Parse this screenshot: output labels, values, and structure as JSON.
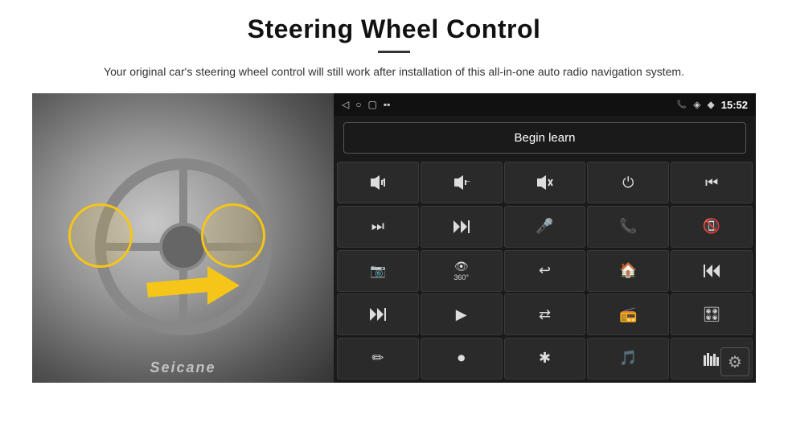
{
  "page": {
    "title": "Steering Wheel Control",
    "subtitle": "Your original car's steering wheel control will still work after installation of this all-in-one auto radio navigation system.",
    "divider": true
  },
  "status_bar": {
    "back_icon": "◁",
    "circle_icon": "○",
    "square_icon": "▢",
    "signal_icon": "▪▪",
    "phone_icon": "📞",
    "wifi_icon": "◈",
    "location_icon": "◆",
    "time": "15:52"
  },
  "begin_learn": {
    "label": "Begin learn"
  },
  "control_buttons": [
    {
      "icon": "🔊+",
      "label": "vol-up"
    },
    {
      "icon": "🔊−",
      "label": "vol-down"
    },
    {
      "icon": "🔇",
      "label": "mute"
    },
    {
      "icon": "⏻",
      "label": "power"
    },
    {
      "icon": "⏮",
      "label": "prev-track"
    },
    {
      "icon": "⏭",
      "label": "next"
    },
    {
      "icon": "⏭⏭",
      "label": "fast-forward"
    },
    {
      "icon": "🎤",
      "label": "mic"
    },
    {
      "icon": "📞",
      "label": "phone"
    },
    {
      "icon": "↩",
      "label": "hangup"
    },
    {
      "icon": "📷",
      "label": "camera"
    },
    {
      "icon": "360°",
      "label": "360-view"
    },
    {
      "icon": "↩",
      "label": "back"
    },
    {
      "icon": "🏠",
      "label": "home"
    },
    {
      "icon": "⏮⏮",
      "label": "skip-back"
    },
    {
      "icon": "⏭⏭",
      "label": "skip-fwd"
    },
    {
      "icon": "▶",
      "label": "nav"
    },
    {
      "icon": "⇄",
      "label": "swap"
    },
    {
      "icon": "📻",
      "label": "radio"
    },
    {
      "icon": "⚙",
      "label": "equalizer"
    },
    {
      "icon": "✏",
      "label": "pen"
    },
    {
      "icon": "⏺",
      "label": "record"
    },
    {
      "icon": "✱",
      "label": "bluetooth"
    },
    {
      "icon": "♪",
      "label": "music"
    },
    {
      "icon": "▊",
      "label": "spectrum"
    }
  ],
  "seicane": {
    "watermark": "Seicane"
  },
  "settings": {
    "icon": "⚙"
  }
}
